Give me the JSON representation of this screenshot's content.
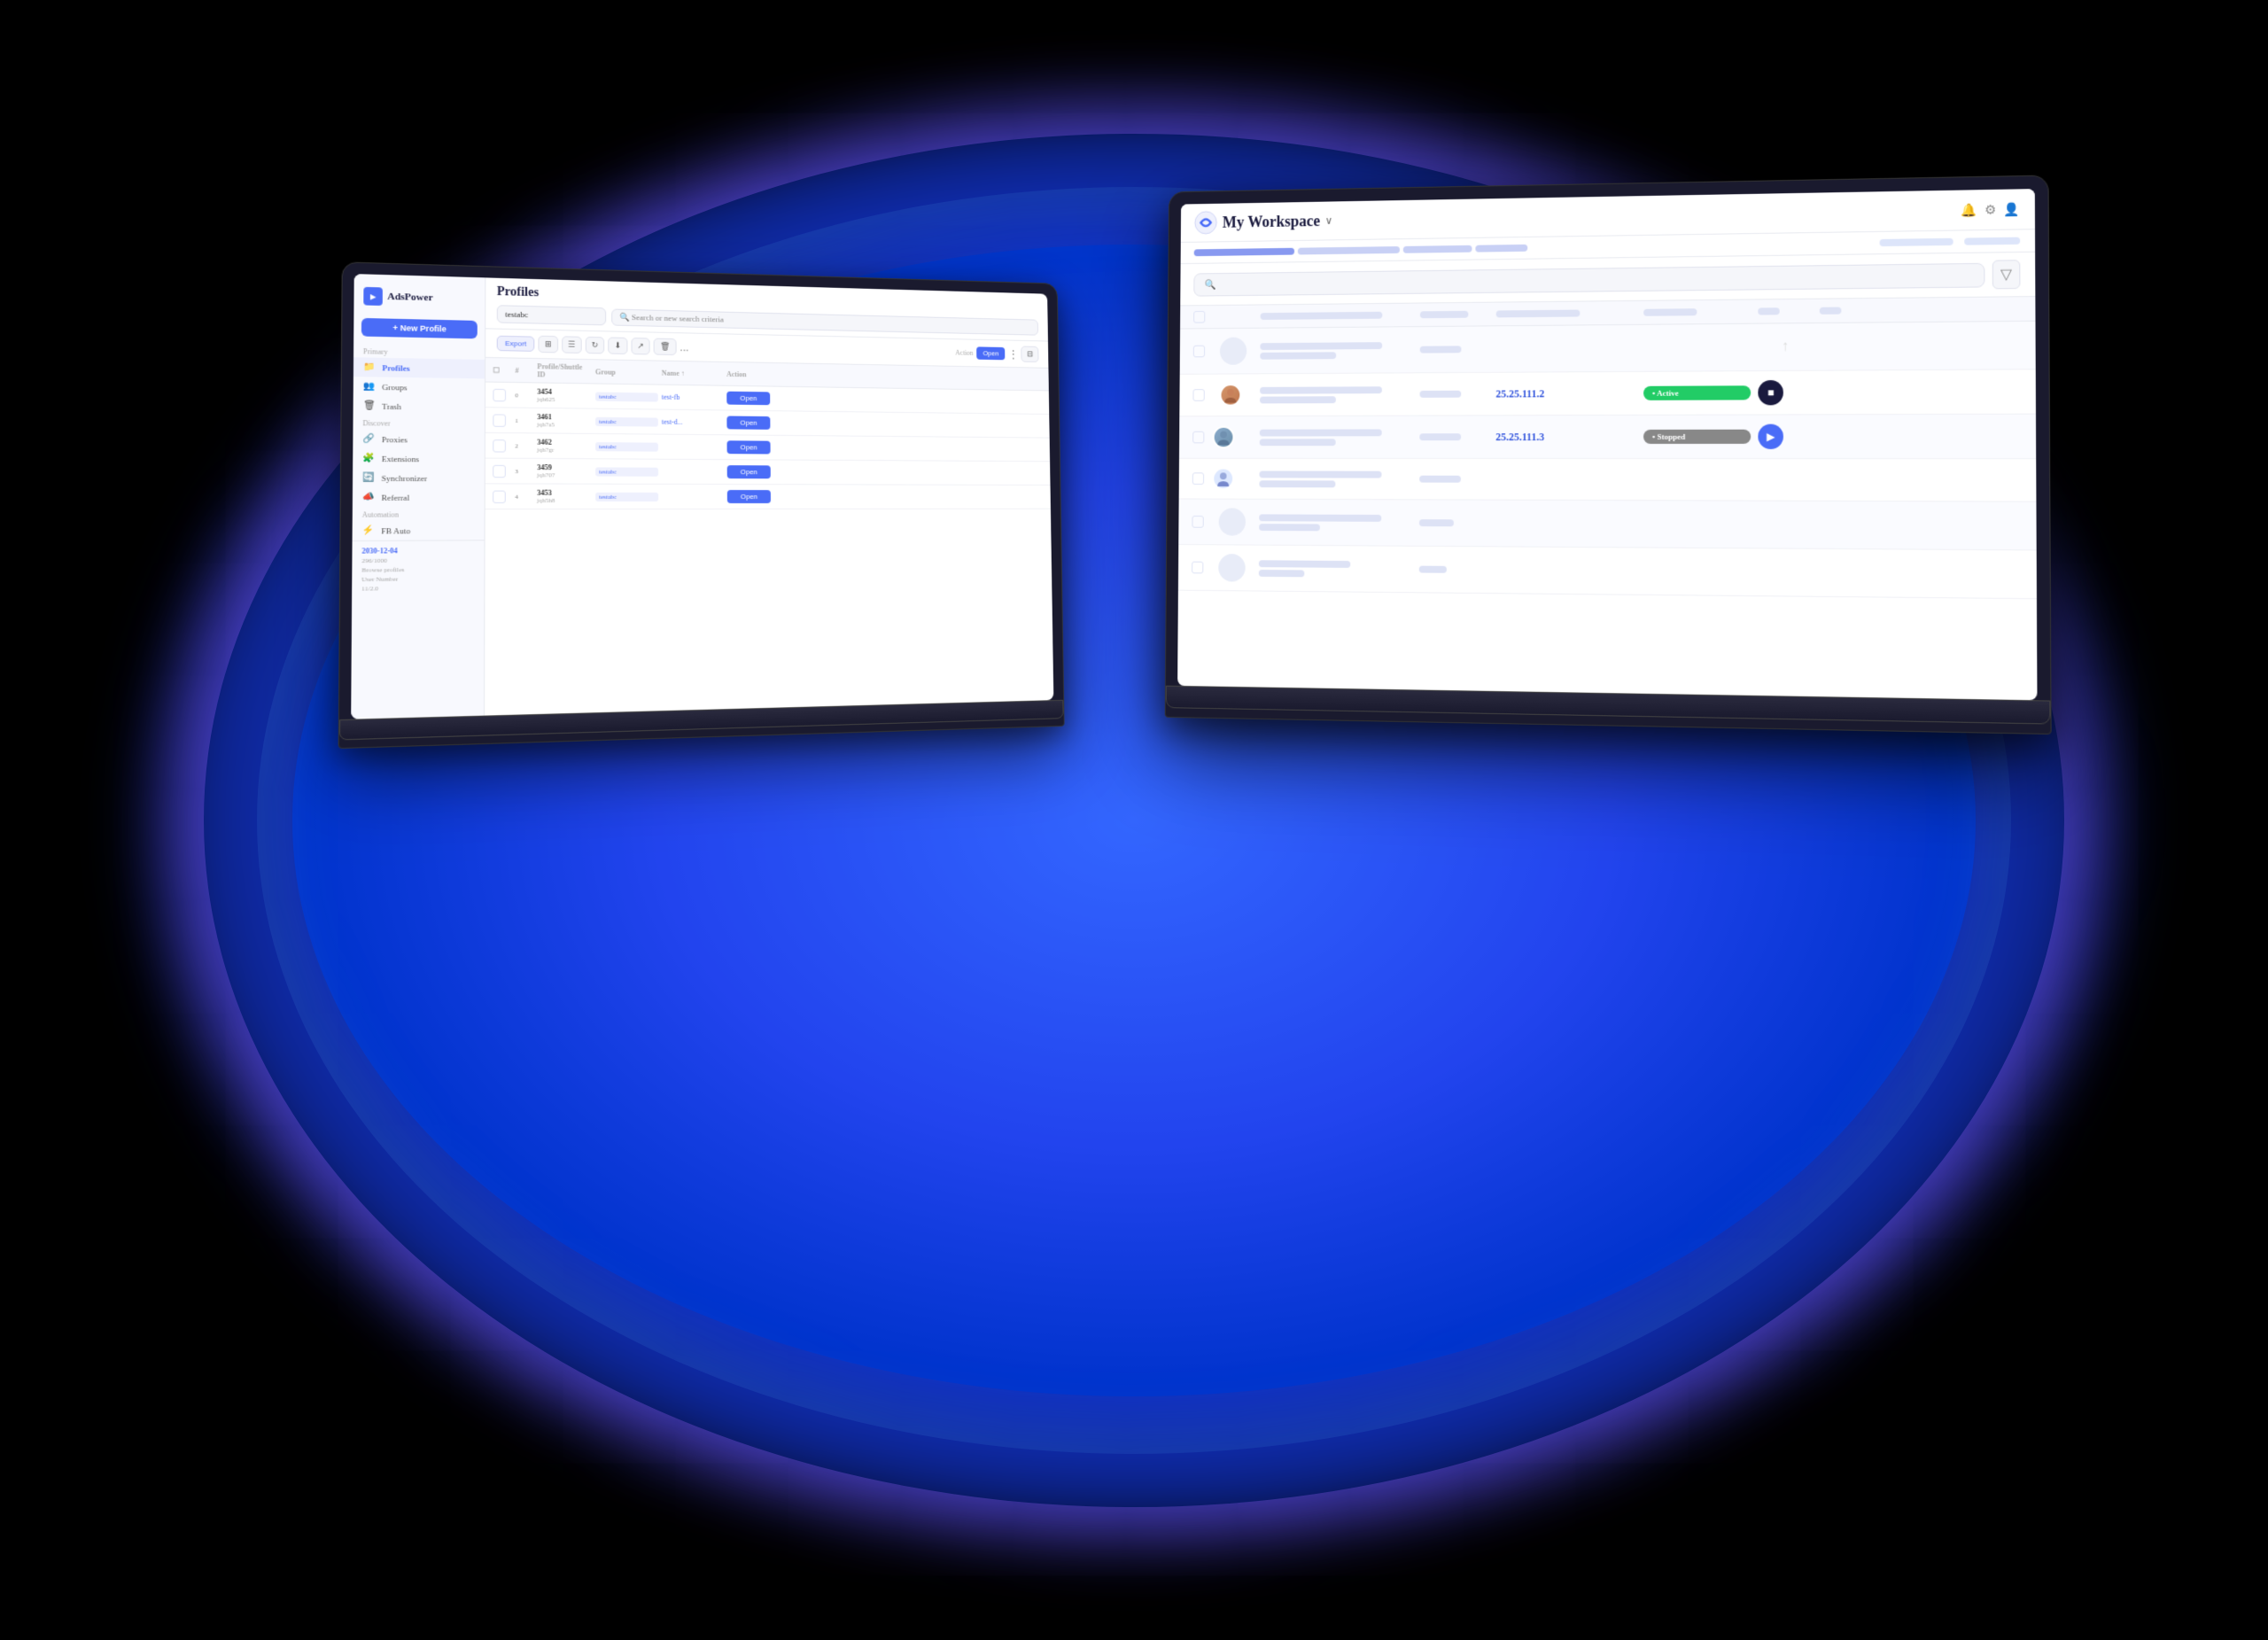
{
  "background": {
    "blob_color": "#1a4fff"
  },
  "laptop1": {
    "sidebar": {
      "logo_text": "AdsPower",
      "new_profile_btn": "+ New Profile",
      "sections": {
        "primary_label": "Primary",
        "items": [
          {
            "label": "Profiles",
            "icon": "📁",
            "active": true
          },
          {
            "label": "Groups",
            "icon": "👥",
            "active": false
          },
          {
            "label": "Trash",
            "icon": "🗑",
            "active": false
          }
        ],
        "discover_label": "Discover",
        "discover_items": [
          {
            "label": "Proxies",
            "icon": "🔗"
          },
          {
            "label": "Extensions",
            "icon": "🧩"
          },
          {
            "label": "Synchronizer",
            "icon": "🔄"
          },
          {
            "label": "Referral",
            "icon": "📣"
          }
        ],
        "automation_label": "Automation",
        "automation_items": [
          {
            "label": "FB Auto",
            "icon": "⚡"
          }
        ]
      },
      "bottom": {
        "date": "2030-12-04",
        "browse_profiles": "Browse profiles",
        "user_number": "User Number",
        "count": "296/1000",
        "version": "11/2.0"
      }
    },
    "profiles": {
      "title": "Profiles",
      "search_placeholder": "Search or new search criteria",
      "search_value": "testabc",
      "toolbar": {
        "export_label": "Export",
        "more_label": "..."
      },
      "table": {
        "columns": [
          "",
          "#",
          "Profile/Shuttle ID",
          "Group",
          "Name ↑",
          "Action"
        ],
        "rows": [
          {
            "num": "0",
            "id": "3454",
            "sub_id": "jqh625",
            "group": "testabc",
            "fb_tag": "test-fb",
            "action": "Open"
          },
          {
            "num": "1",
            "id": "3461",
            "sub_id": "jqh7a5",
            "group": "testabc",
            "fb_tag": "test-d...",
            "action": "Open"
          },
          {
            "num": "2",
            "id": "3462",
            "sub_id": "jqh7gr",
            "group": "testabc",
            "action": "Open"
          },
          {
            "num": "3",
            "id": "3459",
            "sub_id": "jqh707",
            "group": "testabc",
            "action": "Open"
          },
          {
            "num": "4",
            "id": "3453",
            "sub_id": "jqh5h8",
            "group": "testabc",
            "action": "Open"
          }
        ]
      }
    }
  },
  "laptop2": {
    "header": {
      "logo_alt": "AdsPower icon",
      "workspace_title": "My Workspace",
      "chevron": "∨",
      "icons": [
        "🔔",
        "⚙"
      ]
    },
    "filter_tabs": [
      {
        "label": "",
        "active": false,
        "width": 120
      },
      {
        "label": "",
        "active": true,
        "width": 90
      },
      {
        "label": "",
        "active": false,
        "width": 70
      },
      {
        "label": "",
        "active": false,
        "width": 80
      }
    ],
    "search": {
      "placeholder": "🔍",
      "filter_icon": "▽"
    },
    "table": {
      "rows": [
        {
          "type": "placeholder",
          "has_avatar": false,
          "has_ip": false,
          "has_status": false,
          "action": "up"
        },
        {
          "type": "data",
          "has_avatar": true,
          "avatar_type": "person1",
          "ip": "25.25.111.2",
          "has_status": true,
          "status": "Active",
          "action": "stop"
        },
        {
          "type": "data",
          "has_avatar": true,
          "avatar_type": "person2",
          "ip": "25.25.111.3",
          "has_status": true,
          "status": "Stopped",
          "action": "play"
        },
        {
          "type": "placeholder",
          "has_avatar": true,
          "avatar_type": "blue",
          "has_ip": false,
          "has_status": false,
          "action": "none"
        },
        {
          "type": "placeholder",
          "has_avatar": false,
          "has_ip": false,
          "has_status": false,
          "action": "none"
        },
        {
          "type": "placeholder",
          "has_avatar": false,
          "has_ip": false,
          "has_status": false,
          "action": "none"
        }
      ]
    },
    "status_labels": {
      "active": "• Active",
      "stopped": "• Stopped"
    },
    "ips": {
      "ip1": "25.25.111.2",
      "ip2": "25.25.111.3"
    }
  }
}
